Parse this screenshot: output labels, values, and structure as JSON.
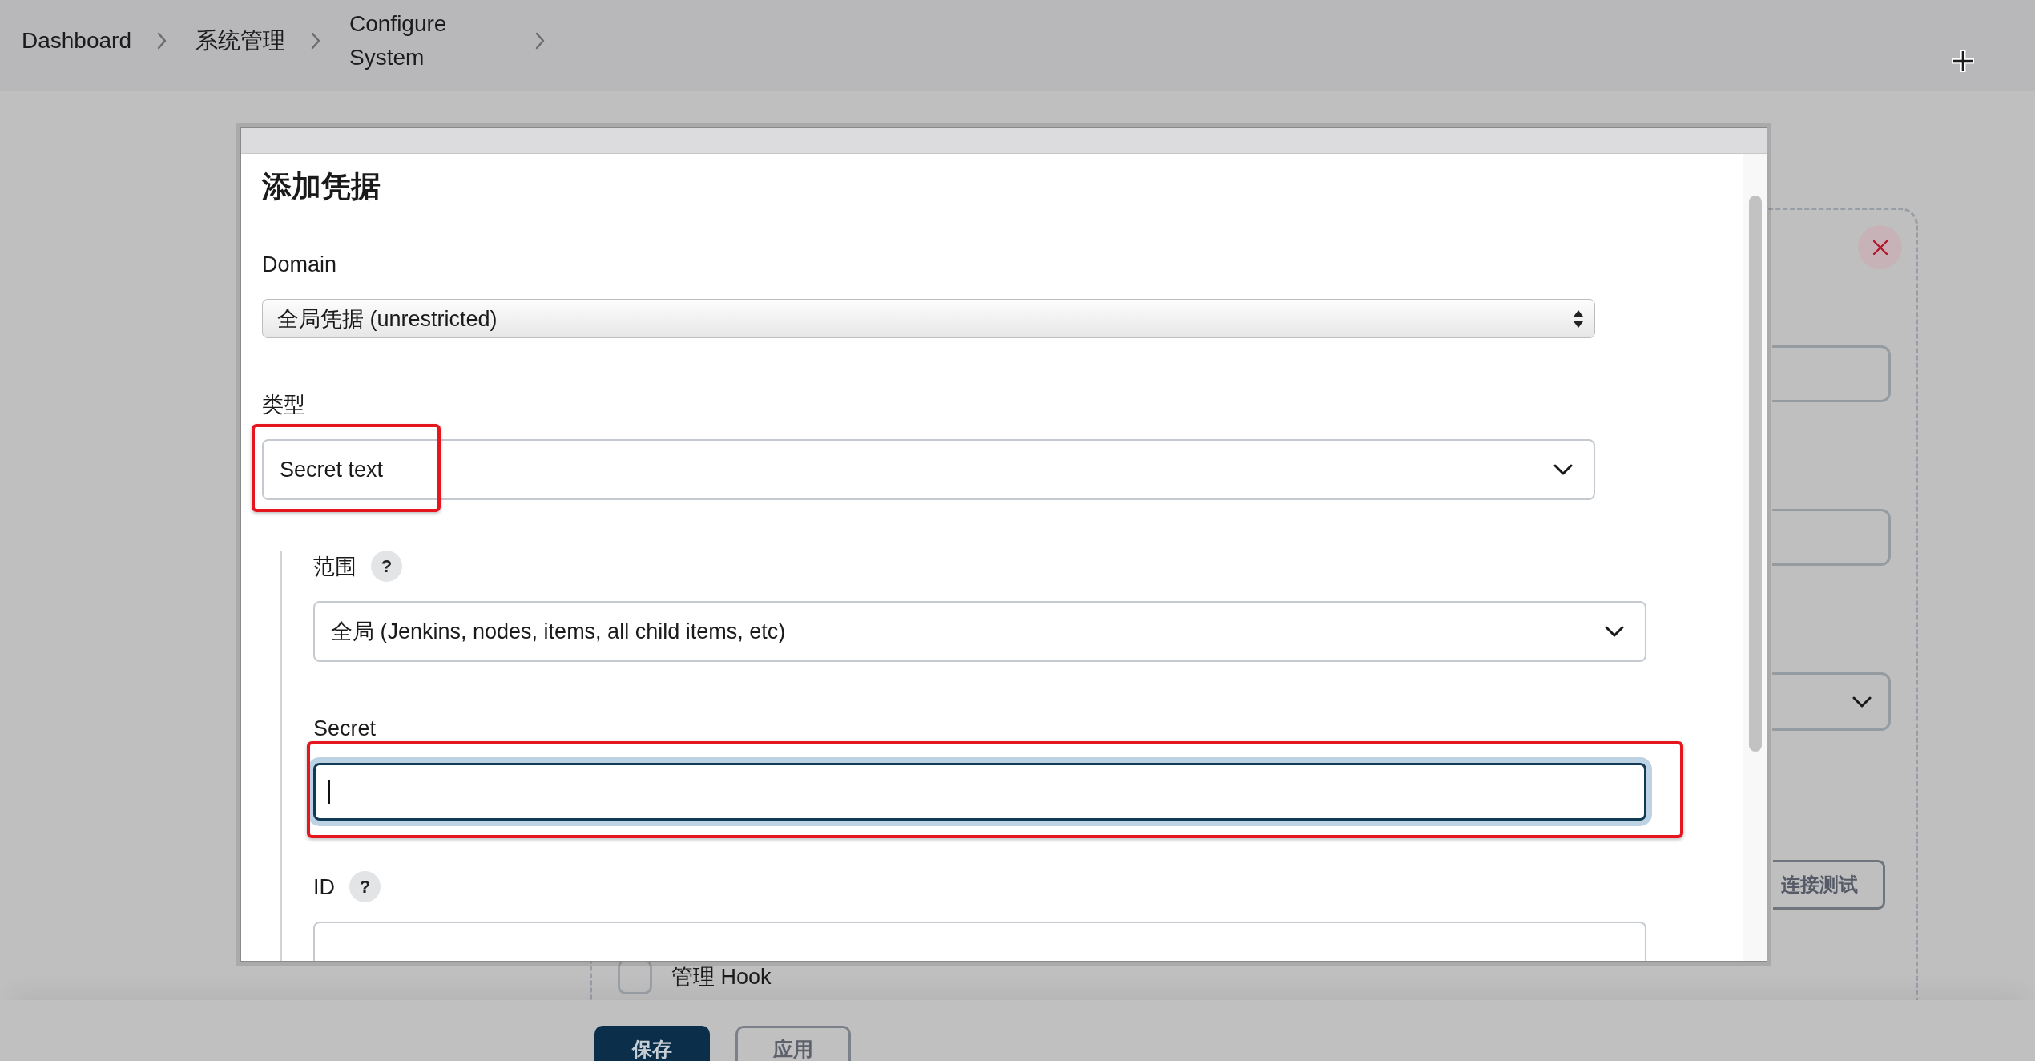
{
  "breadcrumb": [
    {
      "label": "Dashboard"
    },
    {
      "label": "系统管理"
    },
    {
      "label": "Configure System"
    }
  ],
  "background_form": {
    "fields": [
      {
        "kind": "input"
      },
      {
        "kind": "input"
      },
      {
        "kind": "select"
      }
    ],
    "test_button": "连接测试",
    "checkbox": {
      "label": "管理 Hook",
      "checked": false
    }
  },
  "buttons": [
    {
      "label": "保存",
      "kind": "primary"
    },
    {
      "label": "应用",
      "kind": "secondary"
    }
  ],
  "dialog": {
    "title": "添加凭据",
    "fields": [
      {
        "kind": "native-select",
        "label": "Domain",
        "value": "全局凭据 (unrestricted)",
        "focused": false,
        "highlighted": false
      },
      {
        "kind": "select",
        "label": "类型",
        "value": "Secret text",
        "focused": false,
        "highlighted": true
      }
    ],
    "nested_fields": [
      {
        "kind": "select",
        "label": "范围",
        "help": "?",
        "value": "全局 (Jenkins, nodes, items, all child items, etc)",
        "focused": false,
        "highlighted": false
      },
      {
        "kind": "input",
        "label": "Secret",
        "focused": true,
        "highlighted": true
      },
      {
        "kind": "input",
        "label": "ID",
        "help": "?",
        "focused": false,
        "highlighted": false
      }
    ]
  }
}
